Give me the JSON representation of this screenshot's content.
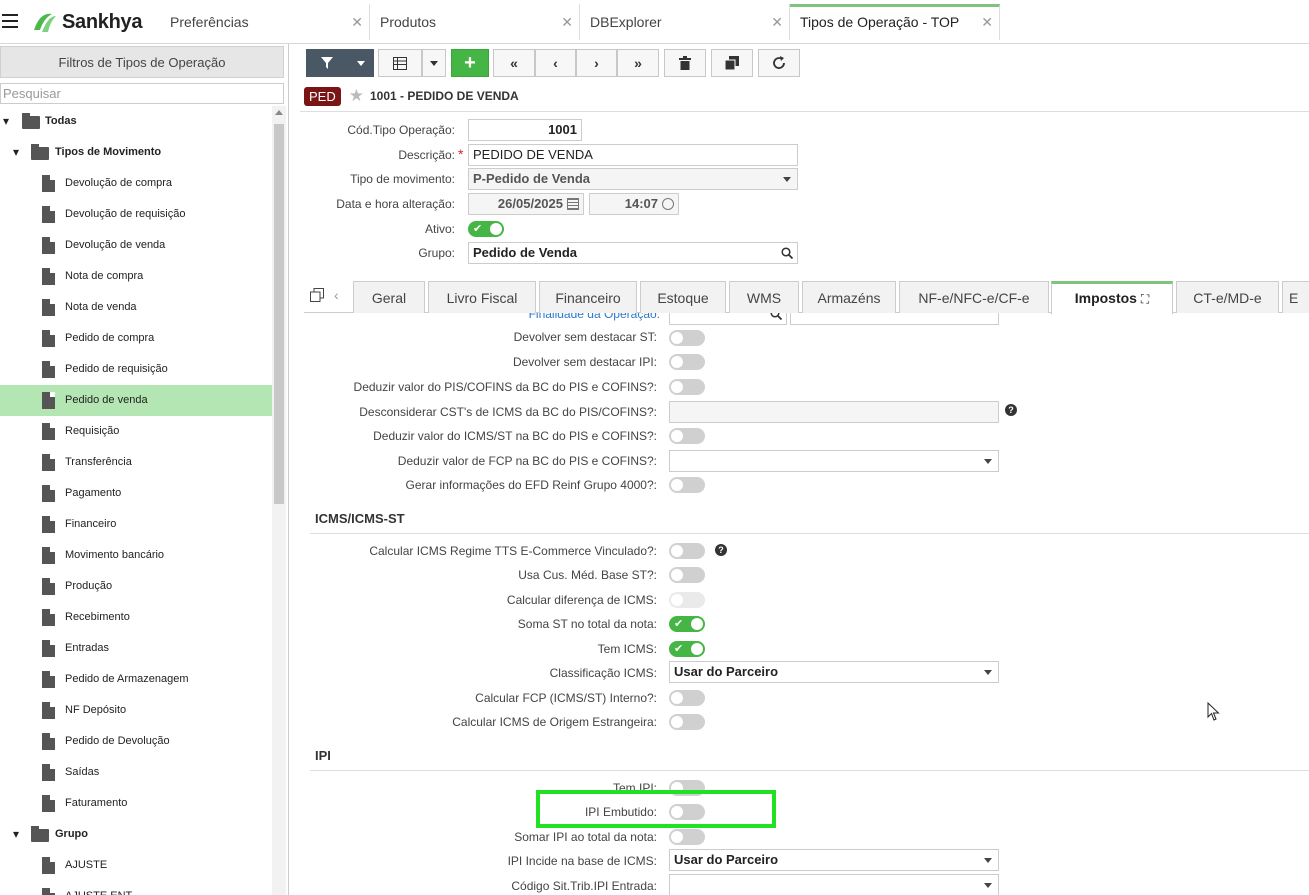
{
  "header": {
    "brand": "Sankhya",
    "tabs": [
      {
        "label": "Preferências"
      },
      {
        "label": "Produtos"
      },
      {
        "label": "DBExplorer"
      },
      {
        "label": "Tipos de Operação - TOP"
      }
    ]
  },
  "sidebar": {
    "title": "Filtros de Tipos de Operação",
    "search_placeholder": "Pesquisar",
    "root": "Todas",
    "group1": "Tipos de Movimento",
    "items": [
      "Devolução de compra",
      "Devolução de requisição",
      "Devolução de venda",
      "Nota de compra",
      "Nota de venda",
      "Pedido de compra",
      "Pedido de requisição",
      "Pedido de venda",
      "Requisição",
      "Transferência",
      "Pagamento",
      "Financeiro",
      "Movimento bancário",
      "Produção",
      "Recebimento",
      "Entradas",
      "Pedido de Armazenagem",
      "NF Depósito",
      "Pedido de Devolução",
      "Saídas",
      "Faturamento"
    ],
    "group2": "Grupo",
    "group2_items": [
      "AJUSTE",
      "AJUSTE ENT"
    ],
    "selected": "Pedido de venda"
  },
  "record": {
    "tag": "PED",
    "title": "1001 - PEDIDO DE VENDA"
  },
  "form": {
    "cod_label": "Cód.Tipo Operação:",
    "cod_value": "1001",
    "desc_label": "Descrição:",
    "desc_value": "PEDIDO DE VENDA",
    "tipo_label": "Tipo de movimento:",
    "tipo_value": "P-Pedido de Venda",
    "data_label": "Data e hora alteração:",
    "data_value": "26/05/2025",
    "hora_value": "14:07",
    "ativo_label": "Ativo:",
    "grupo_label": "Grupo:",
    "grupo_value": "Pedido de Venda"
  },
  "form_tabs": [
    "Geral",
    "Livro Fiscal",
    "Financeiro",
    "Estoque",
    "WMS",
    "Armazéns",
    "NF-e/NFC-e/CF-e",
    "Impostos",
    "CT-e/MD-e",
    "E"
  ],
  "impostos": {
    "finalidade_label": "Finalidade da Operação:",
    "rows_top": [
      "Devolver sem destacar ST:",
      "Devolver sem destacar IPI:",
      "Deduzir valor do PIS/COFINS da BC do PIS e COFINS?:",
      "Desconsiderar CST's de ICMS da BC do PIS/COFINS?:",
      "Deduzir valor do ICMS/ST na BC do PIS e COFINS?:",
      "Deduzir valor de FCP na BC do PIS e COFINS?:",
      "Gerar informações do EFD Reinf Grupo 4000?:"
    ],
    "icms_title": "ICMS/ICMS-ST",
    "icms_rows": [
      "Calcular ICMS Regime TTS E-Commerce Vinculado?:",
      "Usa Cus. Méd. Base ST?:",
      "Calcular diferença de ICMS:",
      "Soma ST no total da nota:",
      "Tem ICMS:",
      "Classificação ICMS:",
      "Calcular FCP (ICMS/ST) Interno?:",
      "Calcular ICMS de Origem Estrangeira:"
    ],
    "classificacao_value": "Usar do Parceiro",
    "ipi_title": "IPI",
    "ipi_rows": [
      "Tem IPI:",
      "IPI Embutido:",
      "Somar IPI ao total da nota:",
      "IPI Incide na base de ICMS:",
      "Código Sit.Trib.IPI Entrada:"
    ],
    "ipi_incide_value": "Usar do Parceiro"
  }
}
